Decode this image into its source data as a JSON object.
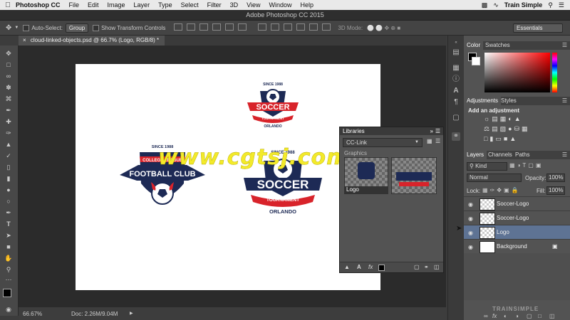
{
  "menubar": {
    "app_name": "Photoshop CC",
    "menus": [
      "File",
      "Edit",
      "Image",
      "Layer",
      "Type",
      "Select",
      "Filter",
      "3D",
      "View",
      "Window",
      "Help"
    ],
    "right_text": "Train Simple"
  },
  "titlebar": {
    "title": "Adobe Photoshop CC 2015"
  },
  "options": {
    "auto_select_label": "Auto-Select:",
    "auto_select_value": "Group",
    "show_transform_label": "Show Transform Controls",
    "mode_label": "3D Mode:",
    "workspace": "Essentials"
  },
  "document": {
    "tab_label": "cloud-linked-objects.psd @ 66.7% (Logo, RGB/8) *",
    "zoom": "66.67%",
    "doc_size": "Doc: 2.26M/9.04M",
    "watermark": "www.cgtsj.com"
  },
  "logos": {
    "since": "SINCE 1988",
    "soccer": "SOCCER",
    "tournament": "TOURNAMENT",
    "orlando": "ORLANDO",
    "college_league": "COLLEGE LEAGUE",
    "football_club": "FOOTBALL CLUB"
  },
  "libraries": {
    "tab": "Libraries",
    "library_name": "CC-Link",
    "section": "Graphics",
    "item_label": "Logo"
  },
  "color_panel": {
    "tabs": [
      "Color",
      "Swatches"
    ]
  },
  "adjustments_panel": {
    "tabs": [
      "Adjustments",
      "Styles"
    ],
    "heading": "Add an adjustment"
  },
  "layers_panel": {
    "tabs": [
      "Layers",
      "Channels",
      "Paths"
    ],
    "filter": "Kind",
    "blend_mode": "Normal",
    "opacity_label": "Opacity:",
    "opacity_value": "100%",
    "lock_label": "Lock:",
    "fill_label": "Fill:",
    "fill_value": "100%",
    "layers": [
      {
        "name": "Soccer-Logo"
      },
      {
        "name": "Soccer-Logo"
      },
      {
        "name": "Logo"
      },
      {
        "name": "Background"
      }
    ]
  },
  "brand_watermark": "TRAINSIMPLE",
  "colors": {
    "accent_red": "#d8232a",
    "navy": "#1d2a55",
    "selection_blue": "#5e7394",
    "watermark_yellow": "#f3ea2a"
  }
}
